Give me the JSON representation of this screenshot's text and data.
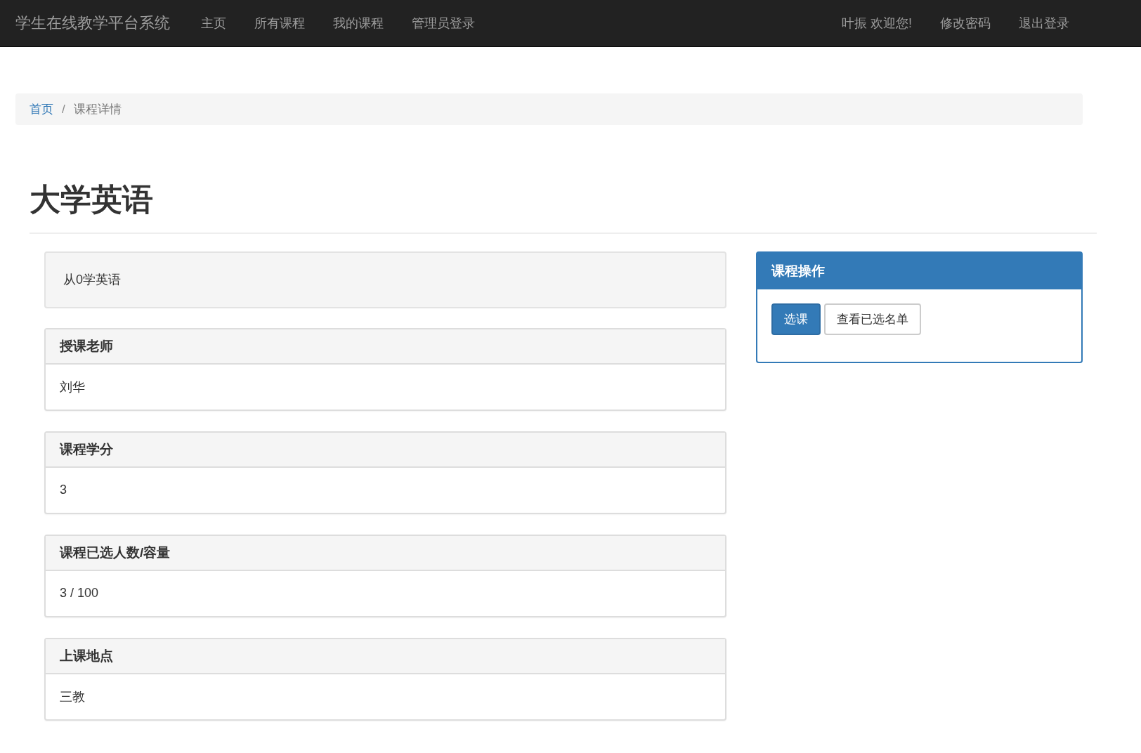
{
  "navbar": {
    "brand": "学生在线教学平台系统",
    "links": [
      "主页",
      "所有课程",
      "我的课程",
      "管理员登录"
    ],
    "right_links": [
      "叶振 欢迎您!",
      "修改密码",
      "退出登录"
    ]
  },
  "breadcrumb": [
    {
      "label": "首页",
      "kind": "link"
    },
    {
      "label": "/",
      "kind": "separator"
    },
    {
      "label": "课程详情",
      "kind": "current"
    }
  ],
  "title": "大学英语",
  "description": "从0学英语",
  "cards": [
    {
      "heading": "授课老师",
      "body": "刘华"
    },
    {
      "heading": "课程学分",
      "body": "3"
    },
    {
      "heading": "课程已选人数/容量",
      "body": "3 / 100"
    },
    {
      "heading": "上课地点",
      "body": "三教"
    }
  ],
  "panel": {
    "title": "课程操作",
    "buttons": [
      {
        "label": "选课",
        "kind": "primary"
      },
      {
        "label": "查看已选名单",
        "kind": "default"
      }
    ]
  }
}
